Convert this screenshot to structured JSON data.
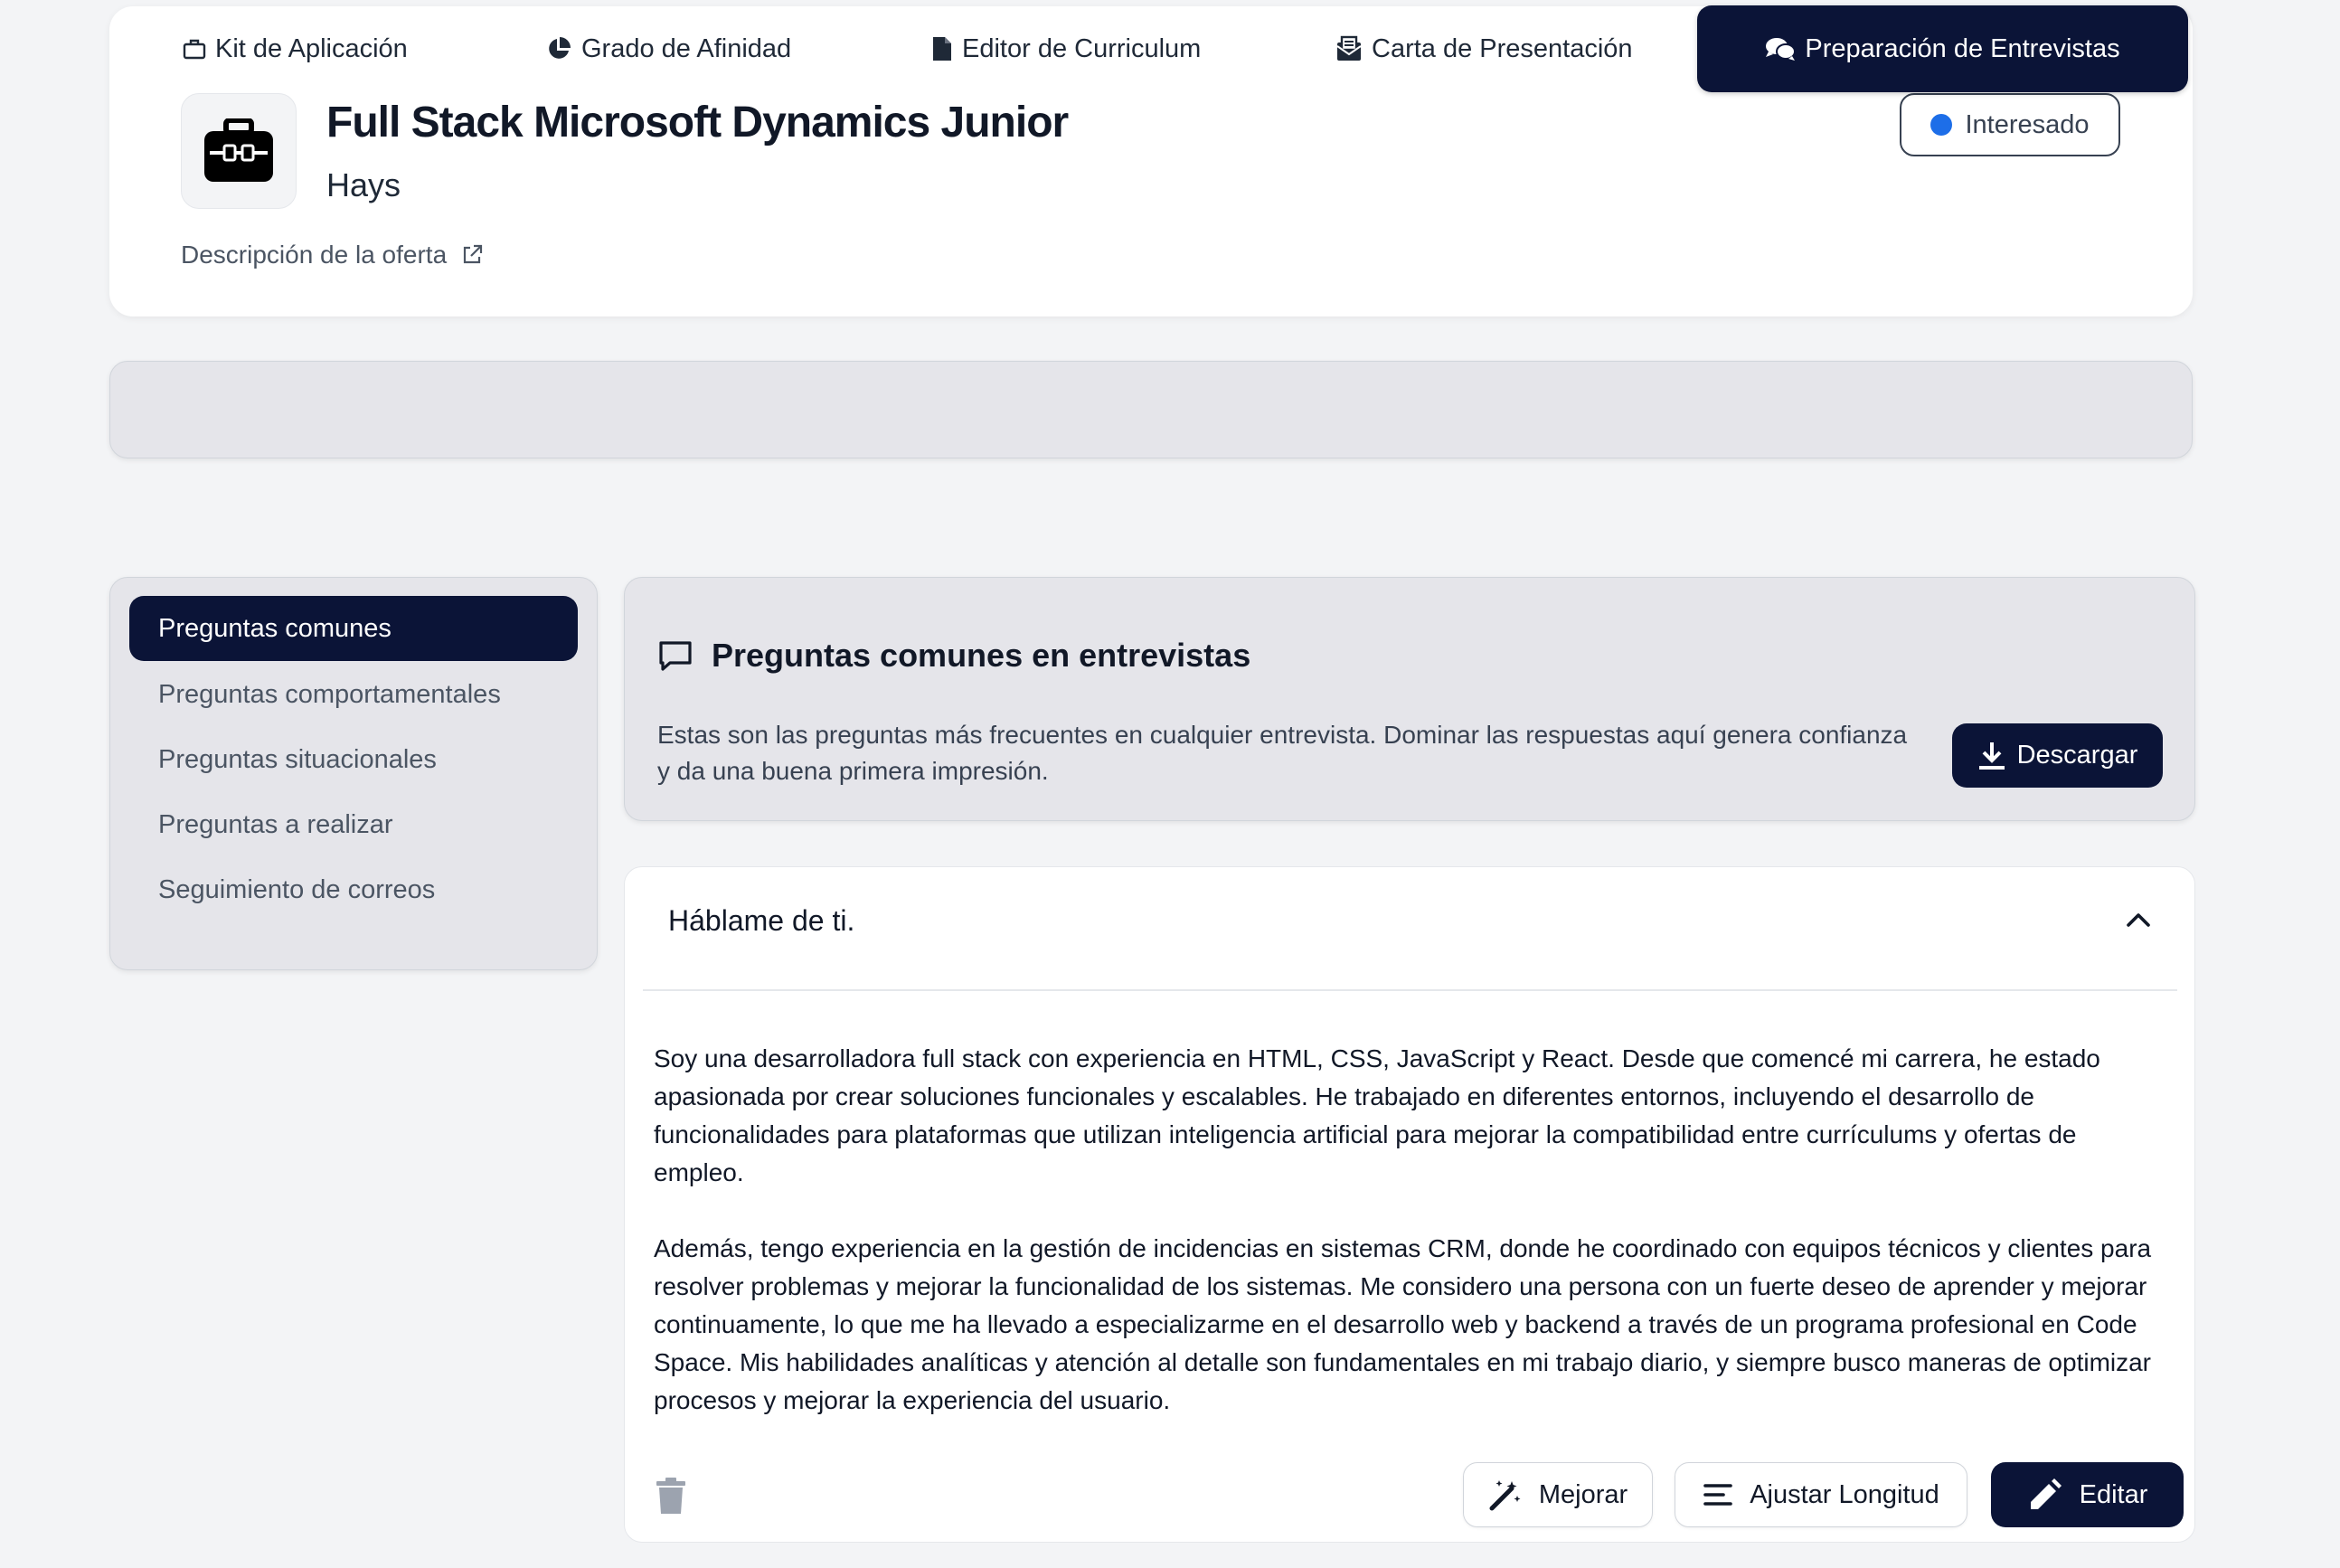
{
  "job": {
    "title": "Full Stack Microsoft Dynamics Junior",
    "company": "Hays",
    "description_link": "Descripción de la oferta",
    "status": "Interesado",
    "logo_icon": "briefcase-icon"
  },
  "tabs": [
    {
      "label": "Kit de Aplicación",
      "icon": "briefcase-outline-icon"
    },
    {
      "label": "Grado de Afinidad",
      "icon": "pie-chart-icon"
    },
    {
      "label": "Editor de Curriculum",
      "icon": "document-icon"
    },
    {
      "label": "Carta de Presentación",
      "icon": "envelope-open-icon"
    },
    {
      "label": "Preparación de Entrevistas",
      "icon": "chat-bubbles-icon",
      "active": true
    }
  ],
  "sidebar": {
    "items": [
      {
        "label": "Preguntas comunes",
        "active": true
      },
      {
        "label": "Preguntas comportamentales"
      },
      {
        "label": "Preguntas situacionales"
      },
      {
        "label": "Preguntas a realizar"
      },
      {
        "label": "Seguimiento de correos"
      }
    ]
  },
  "intro": {
    "title": "Preguntas comunes en entrevistas",
    "description": "Estas son las preguntas más frecuentes en cualquier entrevista. Dominar las respuestas aquí genera confianza y da una buena primera impresión.",
    "download_label": "Descargar"
  },
  "question": {
    "title": "Háblame de ti.",
    "answer_p1": "Soy una desarrolladora full stack con experiencia en HTML, CSS, JavaScript y React. Desde que comencé mi carrera, he estado apasionada por crear soluciones funcionales y escalables. He trabajado en diferentes entornos, incluyendo el desarrollo de funcionalidades para plataformas que utilizan inteligencia artificial para mejorar la compatibilidad entre currículums y ofertas de empleo.",
    "answer_p2": "Además, tengo experiencia en la gestión de incidencias en sistemas CRM, donde he coordinado con equipos técnicos y clientes para resolver problemas y mejorar la funcionalidad de los sistemas. Me considero una persona con un fuerte deseo de aprender y mejorar continuamente, lo que me ha llevado a especializarme en el desarrollo web y backend a través de un programa profesional en Code Space. Mis habilidades analíticas y atención al detalle son fundamentales en mi trabajo diario, y siempre busco maneras de optimizar procesos y mejorar la experiencia del usuario.",
    "actions": {
      "improve": "Mejorar",
      "adjust": "Ajustar Longitud",
      "edit": "Editar"
    }
  },
  "colors": {
    "primary_dark": "#0b1437",
    "status_dot": "#1d6ee8",
    "panel_bg": "#e5e5ea",
    "page_bg": "#f3f4f6"
  }
}
